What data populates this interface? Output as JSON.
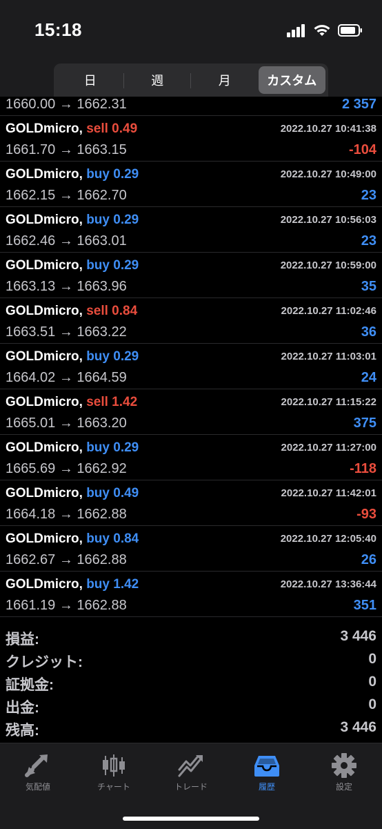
{
  "status_bar": {
    "time": "15:18"
  },
  "segments": [
    {
      "label": "日"
    },
    {
      "label": "週"
    },
    {
      "label": "月"
    },
    {
      "label": "カスタム"
    }
  ],
  "first_row": {
    "prices": "1660.00 → 1662.31",
    "profit": "2 357",
    "profit_color": "blue"
  },
  "trades": [
    {
      "symbol": "GOLDmicro,",
      "side": "sell",
      "volume": "0.49",
      "time": "2022.10.27 10:41:38",
      "prices": "1661.70 → 1663.15",
      "profit": "-104"
    },
    {
      "symbol": "GOLDmicro,",
      "side": "buy",
      "volume": "0.29",
      "time": "2022.10.27 10:49:00",
      "prices": "1662.15 → 1662.70",
      "profit": "23"
    },
    {
      "symbol": "GOLDmicro,",
      "side": "buy",
      "volume": "0.29",
      "time": "2022.10.27 10:56:03",
      "prices": "1662.46 → 1663.01",
      "profit": "23"
    },
    {
      "symbol": "GOLDmicro,",
      "side": "buy",
      "volume": "0.29",
      "time": "2022.10.27 10:59:00",
      "prices": "1663.13 → 1663.96",
      "profit": "35"
    },
    {
      "symbol": "GOLDmicro,",
      "side": "sell",
      "volume": "0.84",
      "time": "2022.10.27 11:02:46",
      "prices": "1663.51 → 1663.22",
      "profit": "36"
    },
    {
      "symbol": "GOLDmicro,",
      "side": "buy",
      "volume": "0.29",
      "time": "2022.10.27 11:03:01",
      "prices": "1664.02 → 1664.59",
      "profit": "24"
    },
    {
      "symbol": "GOLDmicro,",
      "side": "sell",
      "volume": "1.42",
      "time": "2022.10.27 11:15:22",
      "prices": "1665.01 → 1663.20",
      "profit": "375"
    },
    {
      "symbol": "GOLDmicro,",
      "side": "buy",
      "volume": "0.29",
      "time": "2022.10.27 11:27:00",
      "prices": "1665.69 → 1662.92",
      "profit": "-118"
    },
    {
      "symbol": "GOLDmicro,",
      "side": "buy",
      "volume": "0.49",
      "time": "2022.10.27 11:42:01",
      "prices": "1664.18 → 1662.88",
      "profit": "-93"
    },
    {
      "symbol": "GOLDmicro,",
      "side": "buy",
      "volume": "0.84",
      "time": "2022.10.27 12:05:40",
      "prices": "1662.67 → 1662.88",
      "profit": "26"
    },
    {
      "symbol": "GOLDmicro,",
      "side": "buy",
      "volume": "1.42",
      "time": "2022.10.27 13:36:44",
      "prices": "1661.19 → 1662.88",
      "profit": "351"
    }
  ],
  "summary": [
    {
      "label": "損益:",
      "value": "3 446"
    },
    {
      "label": "クレジット:",
      "value": "0"
    },
    {
      "label": "証拠金:",
      "value": "0"
    },
    {
      "label": "出金:",
      "value": "0"
    },
    {
      "label": "残高:",
      "value": "3 446"
    }
  ],
  "tabs": [
    {
      "label": "気配値",
      "icon": "quotes-arrows-icon"
    },
    {
      "label": "チャート",
      "icon": "candlestick-chart-icon"
    },
    {
      "label": "トレード",
      "icon": "trade-chart-icon"
    },
    {
      "label": "履歴",
      "icon": "history-inbox-icon"
    },
    {
      "label": "設定",
      "icon": "gear-icon"
    }
  ],
  "colors": {
    "buy_blue": "#3f8ef5",
    "sell_red": "#ea4d3d",
    "active_tab": "#3f8ef5"
  }
}
